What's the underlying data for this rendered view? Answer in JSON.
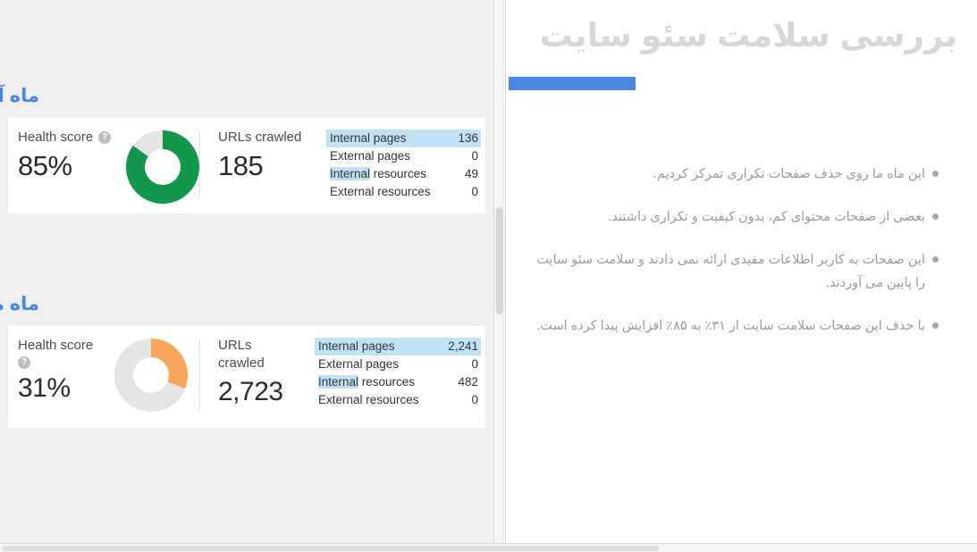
{
  "slide": {
    "title": "بررسی سلامت سئو سایت",
    "accent_color": "#4a86e8",
    "title_color": "#d8d8d8",
    "bullets": [
      "این ماه ما روی حذف صفحات تکراری تمرکز کردیم.",
      "بعضی از صفحات محتوای کم، بدون کیفیت و تکراری داشتند.",
      "این صفحات به کاربر اطلاعات مفیدی ارائه نمی دادند و سلامت سئو سایت را پایین می آوردند.",
      "با حذف این صفحات سلامت سایت از ۳۱٪ به ۸۵٪ افزایش پیدا کرده است."
    ]
  },
  "reports": [
    {
      "month": "ماه آبان",
      "health_label": "Health score",
      "health_value": "85%",
      "health_percent": 85,
      "health_color": "#11984b",
      "health_track_color": "#e4e4e4",
      "urls_label": "URLs crawled",
      "urls_value": "185",
      "help_icon": "help-circle-icon",
      "stats": [
        {
          "name": "Internal pages",
          "value": "136",
          "highlight": "full"
        },
        {
          "name": "External pages",
          "value": "0",
          "highlight": "none"
        },
        {
          "name": "Internal resources",
          "value": "49",
          "highlight": "word",
          "highlight_word": "Internal",
          "rest": " resources"
        },
        {
          "name": "External resources",
          "value": "0",
          "highlight": "none"
        }
      ]
    },
    {
      "month": "ماه مهر",
      "health_label": "Health score",
      "health_value": "31%",
      "health_percent": 31,
      "health_color": "#f8a košt",
      "urls_label_line1": "URLs",
      "urls_label_line2": "crawled",
      "urls_value": "2,723",
      "help_icon": "help-circle-icon",
      "stats": [
        {
          "name": "Internal pages",
          "value": "2,241",
          "highlight": "full"
        },
        {
          "name": "External pages",
          "value": "0",
          "highlight": "none"
        },
        {
          "name": "Internal resources",
          "value": "482",
          "highlight": "word",
          "highlight_word": "Internal",
          "rest": " resources"
        },
        {
          "name": "External resources",
          "value": "0",
          "highlight": "none"
        }
      ]
    }
  ],
  "colors": {
    "green": "#11984b",
    "orange": "#f9a65a",
    "track": "#e4e4e4",
    "highlight": "#bfe3f5",
    "panel_bg": "#efefef",
    "accent_blue": "#4a86e8"
  }
}
